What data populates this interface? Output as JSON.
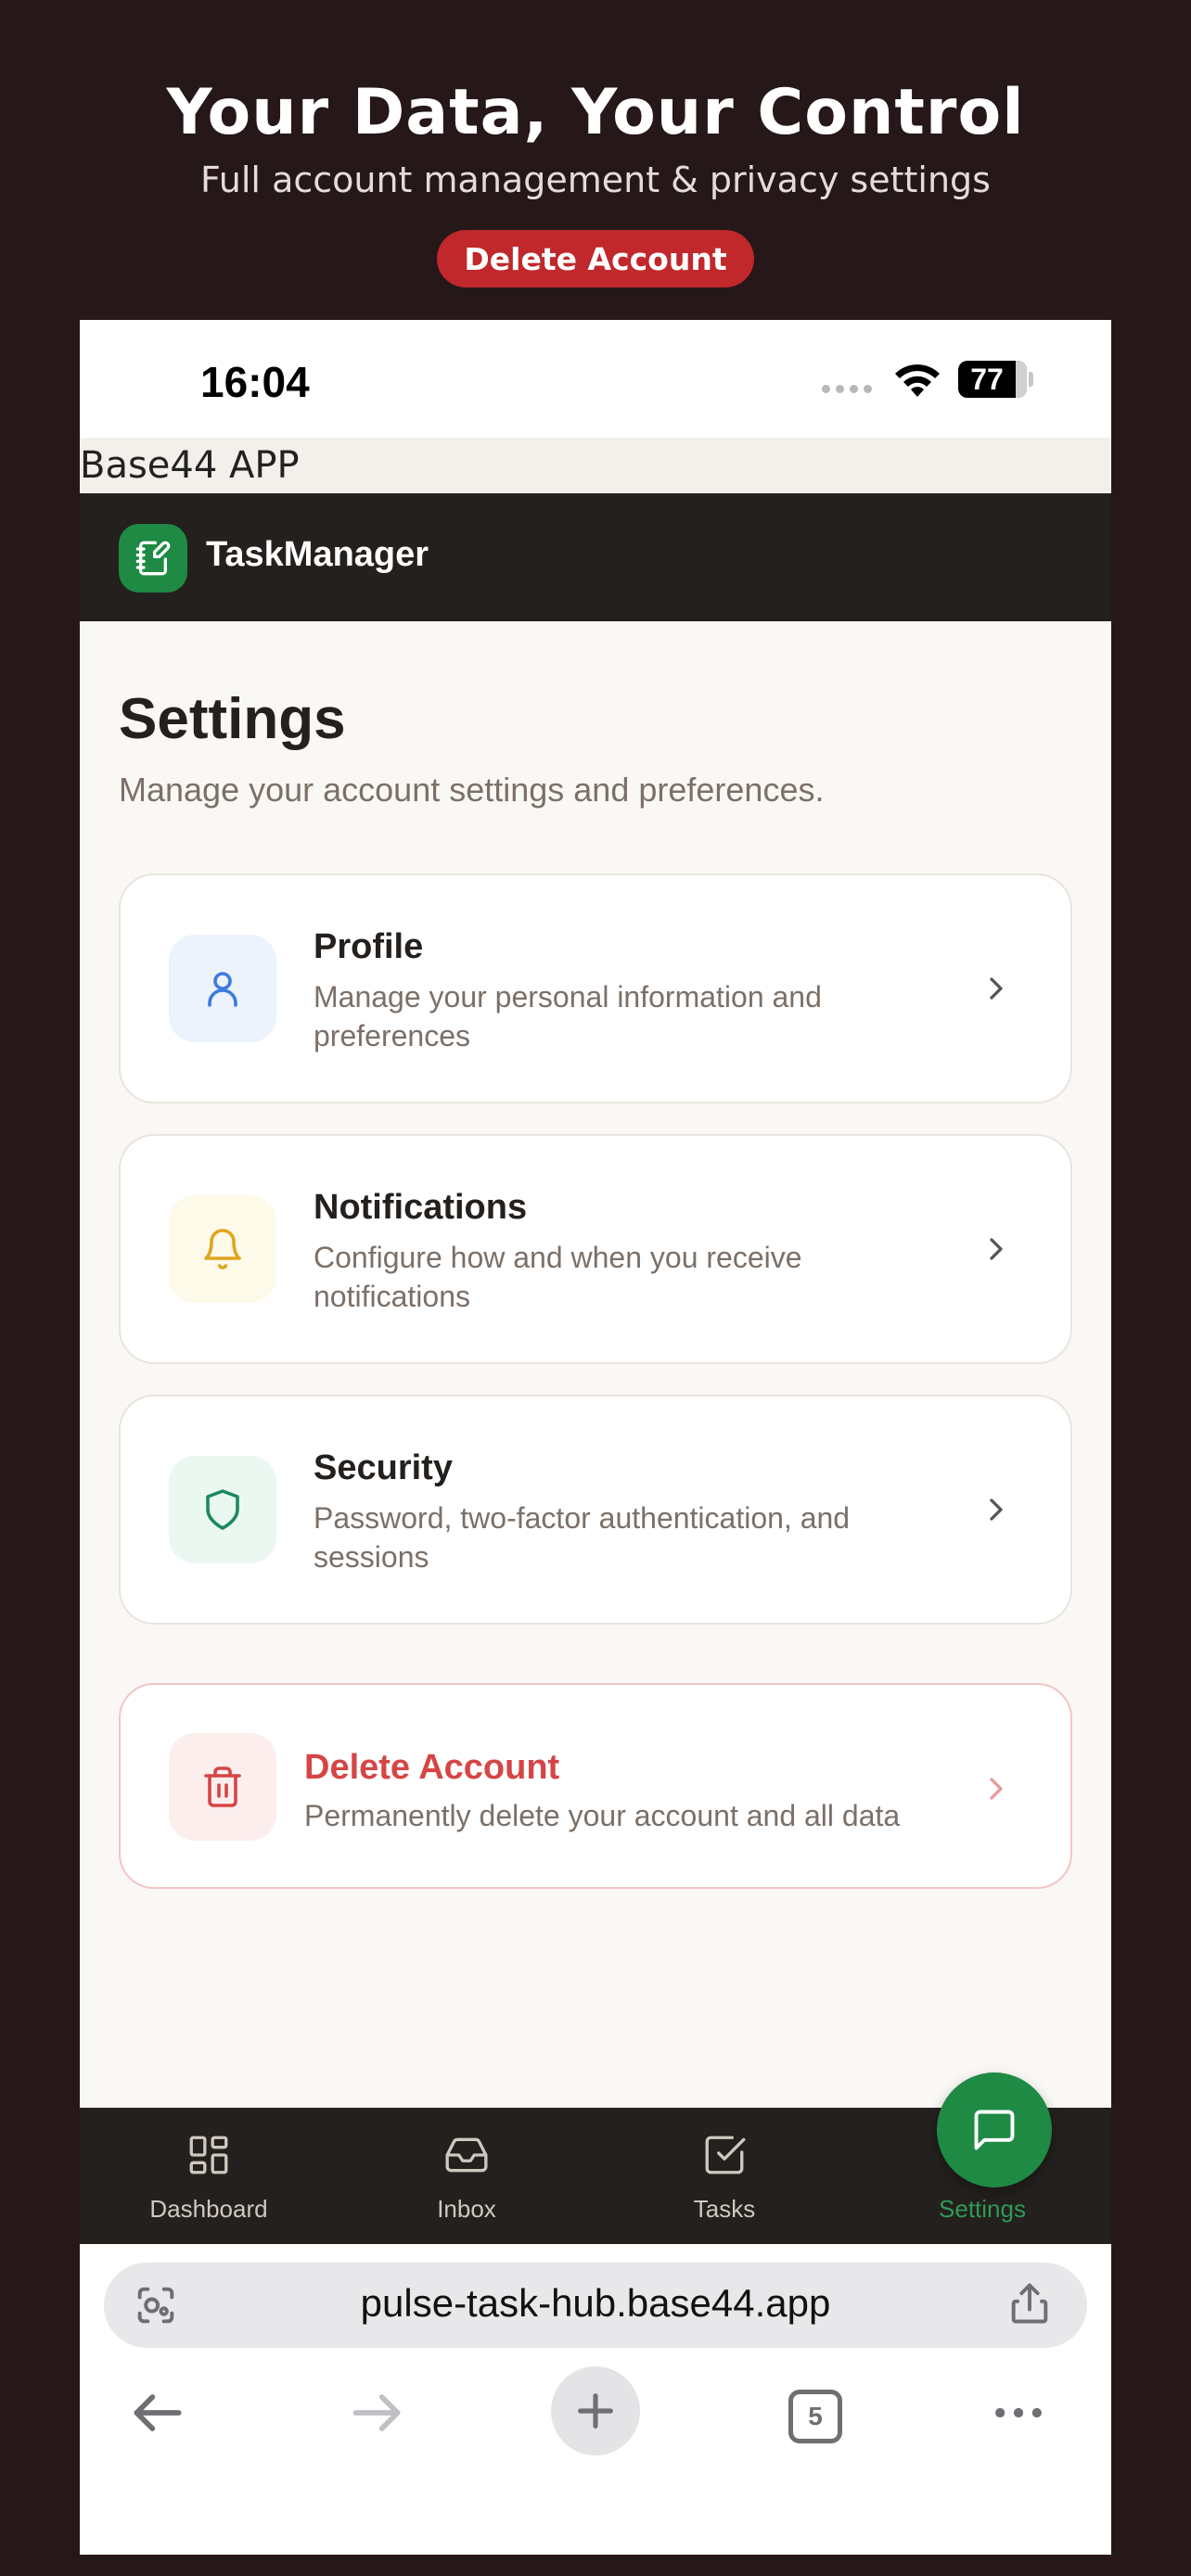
{
  "promo": {
    "title": "Your Data, Your Control",
    "subtitle": "Full account management & privacy settings",
    "badge": "Delete Account",
    "badge_color": "#c0282b"
  },
  "status_bar": {
    "time": "16:04",
    "battery": "77"
  },
  "app_label": "Base44 APP",
  "app_bar": {
    "name": "TaskManager",
    "logo_icon": "notebook-pen-icon",
    "brand_color": "#1e8a44"
  },
  "page": {
    "title": "Settings",
    "subtitle": "Manage your account settings and preferences."
  },
  "settings": [
    {
      "title": "Profile",
      "description": "Manage your personal information and preferences",
      "icon": "user-icon"
    },
    {
      "title": "Notifications",
      "description": "Configure how and when you receive notifications",
      "icon": "bell-icon"
    },
    {
      "title": "Security",
      "description": "Password, two-factor authentication, and sessions",
      "icon": "shield-icon"
    },
    {
      "title": "Delete Account",
      "description": "Permanently delete your account and all data",
      "icon": "trash-icon",
      "danger_color": "#d64545"
    }
  ],
  "bottom_nav": [
    {
      "label": "Dashboard",
      "icon": "grid-icon"
    },
    {
      "label": "Inbox",
      "icon": "inbox-icon"
    },
    {
      "label": "Tasks",
      "icon": "checkbox-icon"
    },
    {
      "label": "Settings",
      "icon": "settings-icon",
      "active": true
    }
  ],
  "browser": {
    "url": "pulse-task-hub.base44.app",
    "tab_count": "5"
  }
}
